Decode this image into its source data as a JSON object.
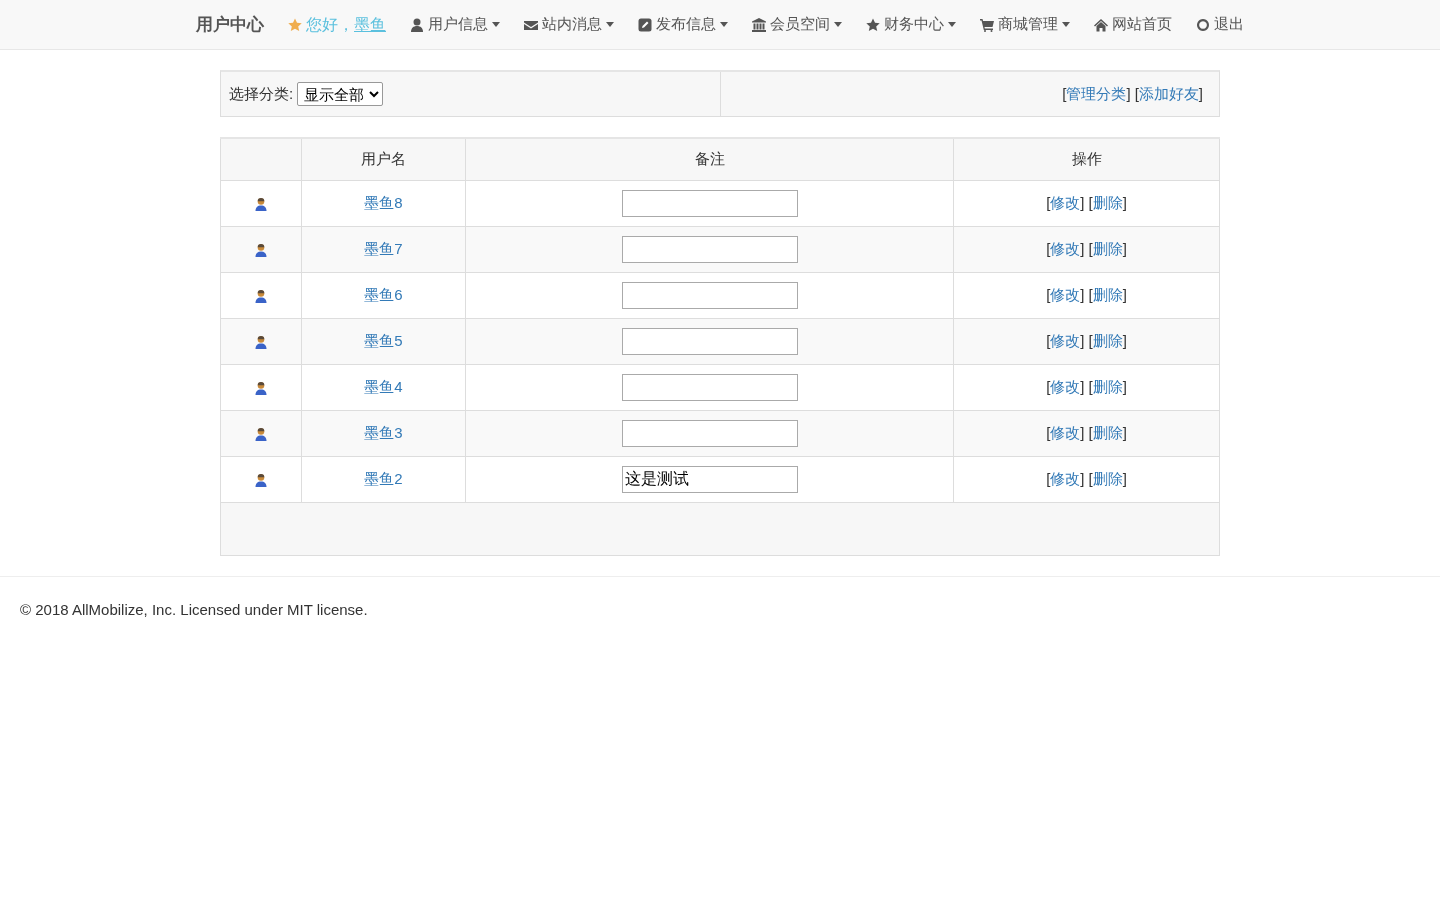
{
  "navbar": {
    "brand": "用户中心",
    "greeting": "您好，",
    "username": "墨鱼",
    "menu": [
      {
        "label": "用户信息",
        "dropdown": true
      },
      {
        "label": "站内消息",
        "dropdown": true
      },
      {
        "label": "发布信息",
        "dropdown": true
      },
      {
        "label": "会员空间",
        "dropdown": true
      },
      {
        "label": "财务中心",
        "dropdown": true
      },
      {
        "label": "商城管理",
        "dropdown": true
      },
      {
        "label": "网站首页",
        "dropdown": false
      },
      {
        "label": "退出",
        "dropdown": false
      }
    ]
  },
  "filter": {
    "label": "选择分类:",
    "value": "显示全部",
    "links": [
      {
        "prefix": "[",
        "label": "管理分类",
        "suffix": "]"
      },
      {
        "prefix": "[",
        "label": "添加好友",
        "suffix": "]"
      }
    ]
  },
  "table": {
    "columns": [
      "用户名",
      "备注",
      "操作"
    ],
    "rows": [
      {
        "username": "墨鱼8",
        "actions": [
          {
            "prefix": "[",
            "label": "修改",
            "suffix": "]"
          },
          {
            "prefix": "[",
            "label": "删除",
            "suffix": "]"
          }
        ]
      },
      {
        "username": "墨鱼7",
        "actions": [
          {
            "prefix": "[",
            "label": "修改",
            "suffix": "]"
          },
          {
            "prefix": "[",
            "label": "删除",
            "suffix": "]"
          }
        ]
      },
      {
        "username": "墨鱼6",
        "actions": [
          {
            "prefix": "[",
            "label": "修改",
            "suffix": "]"
          },
          {
            "prefix": "[",
            "label": "删除",
            "suffix": "]"
          }
        ]
      },
      {
        "username": "墨鱼5",
        "actions": [
          {
            "prefix": "[",
            "label": "修改",
            "suffix": "]"
          },
          {
            "prefix": "[",
            "label": "删除",
            "suffix": "]"
          }
        ]
      },
      {
        "username": "墨鱼4",
        "actions": [
          {
            "prefix": "[",
            "label": "修改",
            "suffix": "]"
          },
          {
            "prefix": "[",
            "label": "删除",
            "suffix": "]"
          }
        ]
      },
      {
        "username": "墨鱼3",
        "actions": [
          {
            "prefix": "[",
            "label": "修改",
            "suffix": "]"
          },
          {
            "prefix": "[",
            "label": "删除",
            "suffix": "]"
          }
        ]
      },
      {
        "username": "墨鱼2",
        "remark": "这是测试",
        "actions": [
          {
            "prefix": "[",
            "label": "修改",
            "suffix": "]"
          },
          {
            "prefix": "[",
            "label": "删除",
            "suffix": "]"
          }
        ]
      }
    ]
  },
  "footer": "© 2018 AllMobilize, Inc. Licensed under MIT license."
}
